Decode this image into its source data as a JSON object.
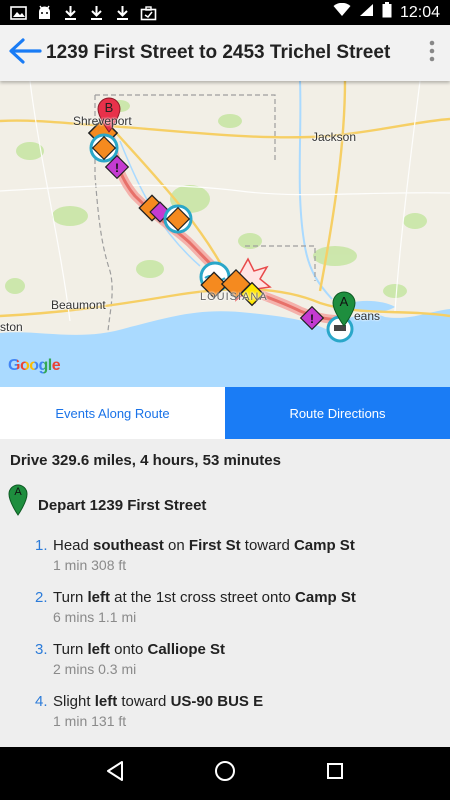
{
  "status_bar": {
    "time": "12:04",
    "icons": [
      "image-icon",
      "android-icon",
      "download-icon",
      "download-icon",
      "download-icon",
      "briefcase-icon"
    ],
    "right_icons": [
      "wifi-icon",
      "signal-icon",
      "battery-icon"
    ]
  },
  "app_bar": {
    "title": "1239 First Street to 2453 Trichel Street",
    "back_icon": "arrow-back-icon",
    "menu_icon": "more-vert-icon"
  },
  "map": {
    "labels": {
      "shreveport": "Shreveport",
      "jackson": "Jackson",
      "beaumont": "Beaumont",
      "houston": "ston",
      "louisiana": "LOUISIANA",
      "new_orleans": "eans"
    },
    "markers": {
      "start": "A",
      "end": "B"
    },
    "logo": "Google",
    "colors": {
      "route": "#f28b82",
      "water": "#aadaff",
      "park": "#c8e6a5",
      "end_marker": "#e8314a",
      "start_marker": "#1e8e3e"
    }
  },
  "tabs": {
    "events": "Events Along Route",
    "directions": "Route Directions",
    "active": "directions"
  },
  "directions": {
    "summary": "Drive 329.6 miles, 4 hours, 53 minutes",
    "depart_marker": "A",
    "depart": "Depart 1239 First Street",
    "steps": [
      {
        "num": "1.",
        "parts": [
          [
            "Head ",
            false
          ],
          [
            "southeast",
            true
          ],
          [
            " on ",
            false
          ],
          [
            "First St",
            true
          ],
          [
            " toward ",
            false
          ],
          [
            "Camp St",
            true
          ]
        ],
        "meta": "1 min 308 ft"
      },
      {
        "num": "2.",
        "parts": [
          [
            "Turn ",
            false
          ],
          [
            "left",
            true
          ],
          [
            " at the 1st cross street onto ",
            false
          ],
          [
            "Camp St",
            true
          ]
        ],
        "meta": "6 mins 1.1 mi"
      },
      {
        "num": "3.",
        "parts": [
          [
            "Turn ",
            false
          ],
          [
            "left",
            true
          ],
          [
            " onto ",
            false
          ],
          [
            "Calliope St",
            true
          ]
        ],
        "meta": "2 mins 0.3 mi"
      },
      {
        "num": "4.",
        "parts": [
          [
            "Slight ",
            false
          ],
          [
            "left",
            true
          ],
          [
            " toward ",
            false
          ],
          [
            "US-90 BUS E",
            true
          ]
        ],
        "meta": "1 min 131 ft"
      }
    ]
  },
  "nav_bar": {
    "icons": [
      "back-triangle-icon",
      "home-circle-icon",
      "recents-square-icon"
    ]
  }
}
